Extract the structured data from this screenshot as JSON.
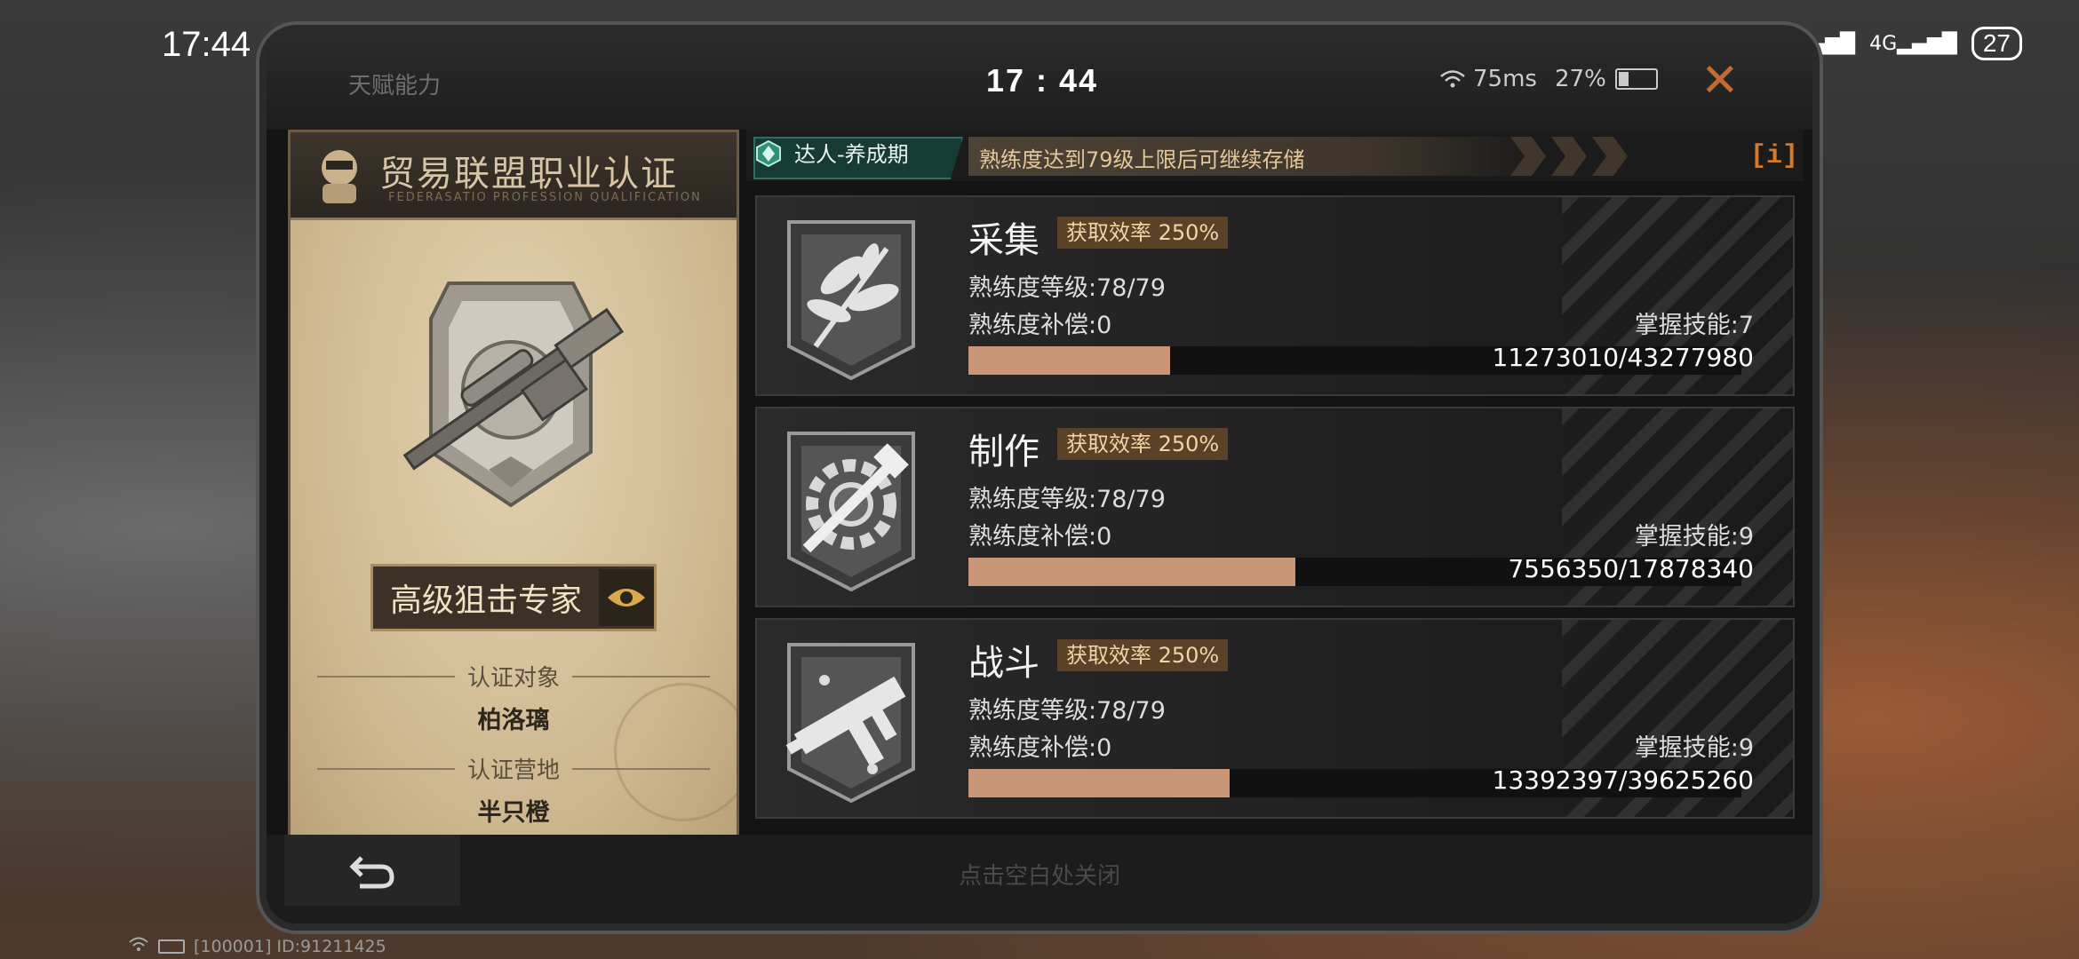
{
  "status_bar": {
    "time": "17:44",
    "battery": "27"
  },
  "window": {
    "title": "天赋能力",
    "clock": "17 : 44",
    "ping": "75ms",
    "battery_pct": "27%"
  },
  "certificate": {
    "title": "贸易联盟职业认证",
    "subtitle": "FEDERASATIO PROFESSION QUALIFICATION",
    "specialty": "高级狙击专家",
    "target_label": "认证对象",
    "target_value": "柏洛璃",
    "camp_label": "认证营地",
    "camp_value": "半只橙"
  },
  "banner": {
    "tag": "达人-养成期",
    "message": "熟练度达到79级上限后可继续存储"
  },
  "professions": [
    {
      "name": "采集",
      "rate": "获取效率 250%",
      "level": "熟练度等级:78/79",
      "compensation": "熟练度补偿:0",
      "skills": "掌握技能:7",
      "progress_text": "11273010/43277980",
      "progress": 0.2605
    },
    {
      "name": "制作",
      "rate": "获取效率 250%",
      "level": "熟练度等级:78/79",
      "compensation": "熟练度补偿:0",
      "skills": "掌握技能:9",
      "progress_text": "7556350/17878340",
      "progress": 0.4227
    },
    {
      "name": "战斗",
      "rate": "获取效率 250%",
      "level": "熟练度等级:78/79",
      "compensation": "熟练度补偿:0",
      "skills": "掌握技能:9",
      "progress_text": "13392397/39625260",
      "progress": 0.338
    }
  ],
  "footer": {
    "close_hint": "点击空白处关闭",
    "device_id": "[100001] ID:91211425"
  },
  "colors": {
    "accent_orange": "#c46a34",
    "bar_fill": "#c99677",
    "rate_bg": "#5a4128",
    "tag_green": "#163a34"
  }
}
